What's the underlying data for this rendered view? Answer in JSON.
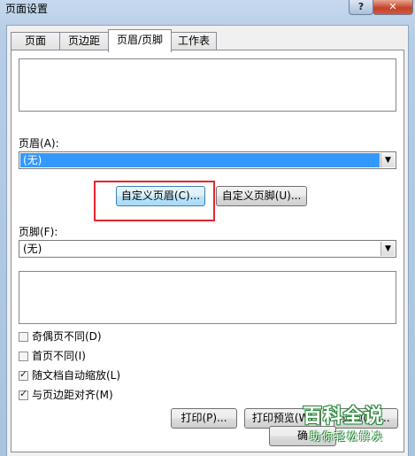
{
  "window": {
    "title": "页面设置",
    "help_label": "?",
    "close_label": "✕"
  },
  "tabs": [
    {
      "label": "页面"
    },
    {
      "label": "页边距"
    },
    {
      "label": "页眉/页脚"
    },
    {
      "label": "工作表"
    }
  ],
  "active_tab": "页眉/页脚",
  "header": {
    "label": "页眉(A):",
    "value": "(无)"
  },
  "custom_header_button": "自定义页眉(C)...",
  "custom_footer_button": "自定义页脚(U)...",
  "footer": {
    "label": "页脚(F):",
    "value": "(无)"
  },
  "options": [
    {
      "label": "奇偶页不同(D)",
      "checked": false
    },
    {
      "label": "首页不同(I)",
      "checked": false
    },
    {
      "label": "随文档自动缩放(L)",
      "checked": true
    },
    {
      "label": "与页边距对齐(M)",
      "checked": true
    }
  ],
  "buttons": {
    "print": "打印(P)...",
    "print_preview": "打印预览(W)",
    "options": "选项(O)...",
    "ok": "确"
  },
  "watermark": {
    "main": "百科全说",
    "sub": "助你轻松解决"
  },
  "colors": {
    "highlight": "#e8242c",
    "selection": "#3399ff"
  }
}
